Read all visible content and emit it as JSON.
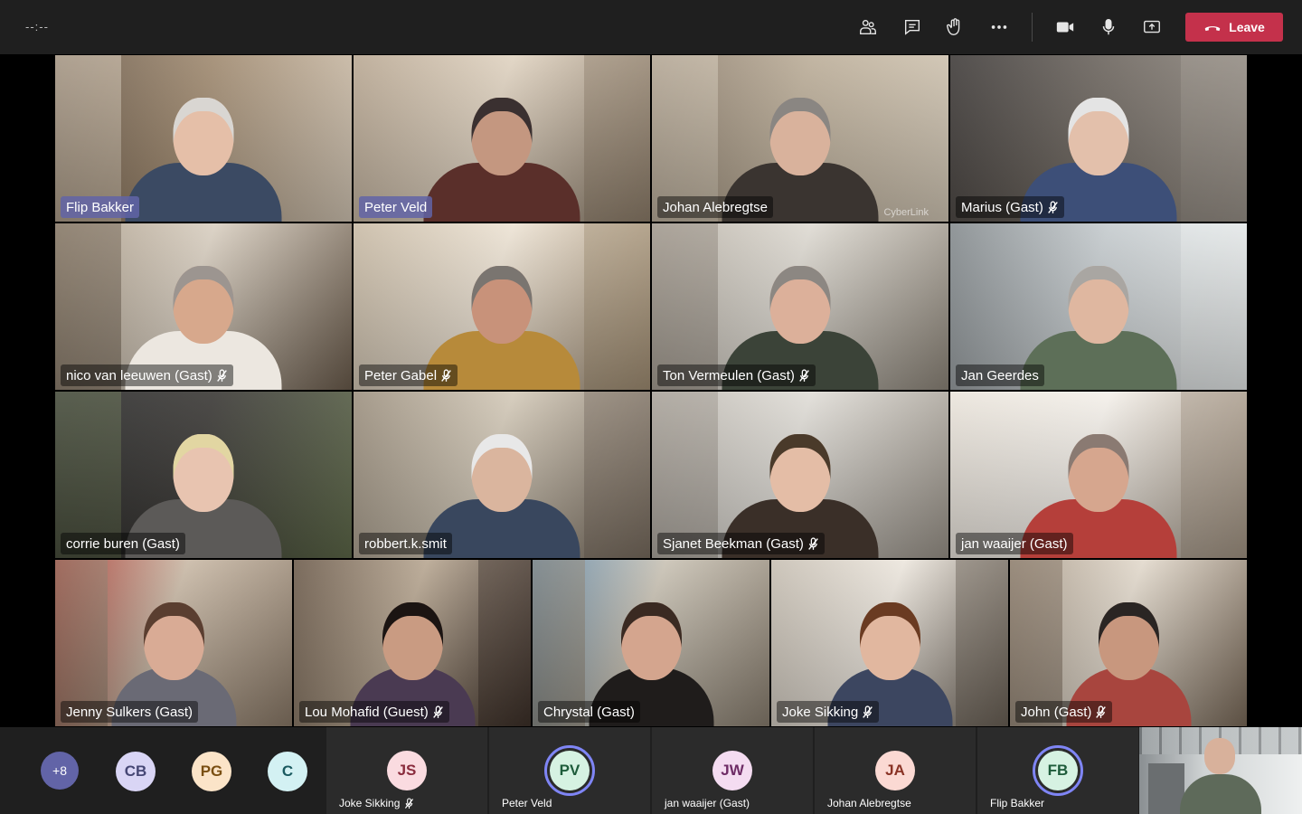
{
  "topbar": {
    "timer": "--:--",
    "buttons": [
      {
        "name": "participants-icon"
      },
      {
        "name": "chat-icon"
      },
      {
        "name": "raise-hand-icon"
      },
      {
        "name": "more-icon"
      },
      {
        "name": "camera-icon"
      },
      {
        "name": "microphone-icon"
      },
      {
        "name": "share-screen-icon"
      }
    ],
    "leave_label": "Leave",
    "leave_color": "#c4314b"
  },
  "tiles": [
    {
      "name": "Flip Bakker",
      "muted": false,
      "highlight": true
    },
    {
      "name": "Peter Veld",
      "muted": false,
      "highlight": true
    },
    {
      "name": "Johan Alebregtse",
      "muted": false,
      "highlight": false,
      "watermark": "CyberLink"
    },
    {
      "name": "Marius (Gast)",
      "muted": true,
      "highlight": false
    },
    {
      "name": "nico van leeuwen (Gast)",
      "muted": true,
      "highlight": false
    },
    {
      "name": "Peter Gabel",
      "muted": true,
      "highlight": false
    },
    {
      "name": "Ton Vermeulen (Gast)",
      "muted": true,
      "highlight": false
    },
    {
      "name": "Jan Geerdes",
      "muted": false,
      "highlight": false
    },
    {
      "name": "corrie buren (Gast)",
      "muted": false,
      "highlight": false
    },
    {
      "name": "robbert.k.smit",
      "muted": false,
      "highlight": false
    },
    {
      "name": "Sjanet Beekman (Gast)",
      "muted": true,
      "highlight": false
    },
    {
      "name": "jan waaijer (Gast)",
      "muted": false,
      "highlight": false
    },
    {
      "name": "Jenny Sulkers (Gast)",
      "muted": false,
      "highlight": false
    },
    {
      "name": "Lou Mohafid (Guest)",
      "muted": true,
      "highlight": false
    },
    {
      "name": "Chrystal (Gast)",
      "muted": false,
      "highlight": false
    },
    {
      "name": "Joke Sikking",
      "muted": true,
      "highlight": false
    },
    {
      "name": "John (Gast)",
      "muted": true,
      "highlight": false
    }
  ],
  "overflow": {
    "count_label": "+8",
    "color": "#6264a7"
  },
  "roster_avatars": [
    {
      "initials": "CB",
      "bg": "#d9d5f5",
      "fg": "#464775"
    },
    {
      "initials": "PG",
      "bg": "#fbe4c8",
      "fg": "#7a4f12"
    },
    {
      "initials": "C",
      "bg": "#d3f1f3",
      "fg": "#1a5a60"
    }
  ],
  "roster_cards": [
    {
      "initials": "JS",
      "label": "Joke Sikking",
      "muted": true,
      "bg": "#fadbe0",
      "fg": "#8a2c3d",
      "active": false
    },
    {
      "initials": "PV",
      "label": "Peter Veld",
      "muted": false,
      "bg": "#d6f2e2",
      "fg": "#1e5c3b",
      "active": true
    },
    {
      "initials": "JW",
      "label": "jan waaijer (Gast)",
      "muted": false,
      "bg": "#f4dcf1",
      "fg": "#6e2c66",
      "active": false
    },
    {
      "initials": "JA",
      "label": "Johan Alebregtse",
      "muted": false,
      "bg": "#fbd9d3",
      "fg": "#8a3325",
      "active": false
    },
    {
      "initials": "FB",
      "label": "Flip Bakker",
      "muted": false,
      "bg": "#d6f2e2",
      "fg": "#1e5c3b",
      "active": true
    }
  ]
}
